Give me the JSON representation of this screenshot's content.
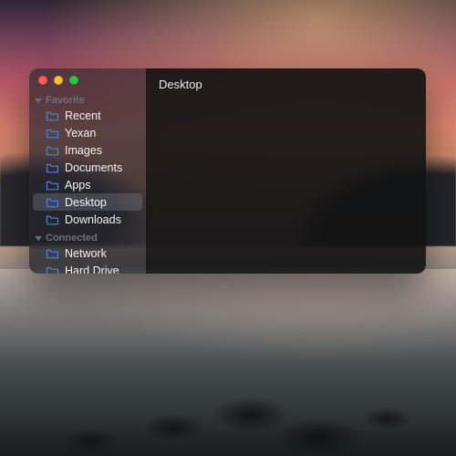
{
  "window": {
    "title": "Desktop",
    "colors": {
      "traffic_red": "#ff5f57",
      "traffic_yellow": "#febc2e",
      "traffic_green": "#28c840",
      "folder_icon": "#3b82f6"
    }
  },
  "sidebar": {
    "sections": [
      {
        "label": "Favorite",
        "items": [
          {
            "label": "Recent"
          },
          {
            "label": "Yexan"
          },
          {
            "label": "Images"
          },
          {
            "label": "Documents"
          },
          {
            "label": "Apps"
          },
          {
            "label": "Desktop",
            "selected": true
          },
          {
            "label": "Downloads"
          }
        ]
      },
      {
        "label": "Connected",
        "items": [
          {
            "label": "Network"
          },
          {
            "label": "Hard Drive"
          }
        ]
      }
    ]
  }
}
